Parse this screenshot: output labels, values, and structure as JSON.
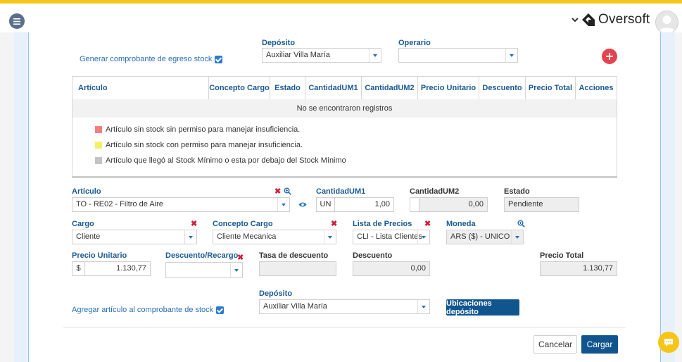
{
  "header": {
    "brand_name": "Oversoft",
    "accent_color": "#f5c518"
  },
  "top": {
    "generate_link": "Generar comprobante de egreso stock",
    "deposito_label": "Depósito",
    "deposito_value": "Auxiliar Villa María",
    "operario_label": "Operario",
    "operario_value": ""
  },
  "table": {
    "columns": [
      "Artículo",
      "Concepto Cargo",
      "Estado",
      "CantidadUM1",
      "CantidadUM2",
      "Precio Unitario",
      "Descuento",
      "Precio Total",
      "Acciones"
    ],
    "empty_text": "No se encontraron registros"
  },
  "legend": [
    {
      "text": "Artículo sin stock sin permiso para manejar insuficiencia.",
      "color": "#f08080"
    },
    {
      "text": "Artículo sin stock con permiso para manejar insuficiencia.",
      "color": "#f2f26a"
    },
    {
      "text": "Artículo que llegó al Stock Mínimo o esta por debajo del Stock Mínimo",
      "color": "#c4c4c4"
    }
  ],
  "form": {
    "articulo_label": "Artículo",
    "articulo_value": "TO - RE02 - Filtro de Aire",
    "cant1_label": "CantidadUM1",
    "cant1_unit": "UN",
    "cant1_value": "1,00",
    "cant2_label": "CantidadUM2",
    "cant2_value": "0,00",
    "estado_label": "Estado",
    "estado_value": "Pendiente",
    "cargo_label": "Cargo",
    "cargo_value": "Cliente",
    "concepto_label": "Concepto Cargo",
    "concepto_value": "Cliente Mecanica",
    "lista_label": "Lista de Precios",
    "lista_value": "CLI - Lista Clientes",
    "moneda_label": "Moneda",
    "moneda_value": "ARS ($) - UNICO",
    "precio_label": "Precio Unitario",
    "precio_currency": "$",
    "precio_value": "1.130,77",
    "desc_recargo_label": "Descuento/Recargo",
    "desc_recargo_value": "",
    "tasa_label": "Tasa de descuento",
    "tasa_value": "",
    "descuento_label": "Descuento",
    "descuento_value": "0,00",
    "total_label": "Precio Total",
    "total_value": "1.130,77",
    "agregar_link": "Agregar artículo al comprobante de stock",
    "deposito2_label": "Depósito",
    "deposito2_value": "Auxiliar Villa María",
    "ubicaciones_btn": "Ubicaciones depósito"
  },
  "footer": {
    "cancel_label": "Cancelar",
    "submit_label": "Cargar"
  }
}
